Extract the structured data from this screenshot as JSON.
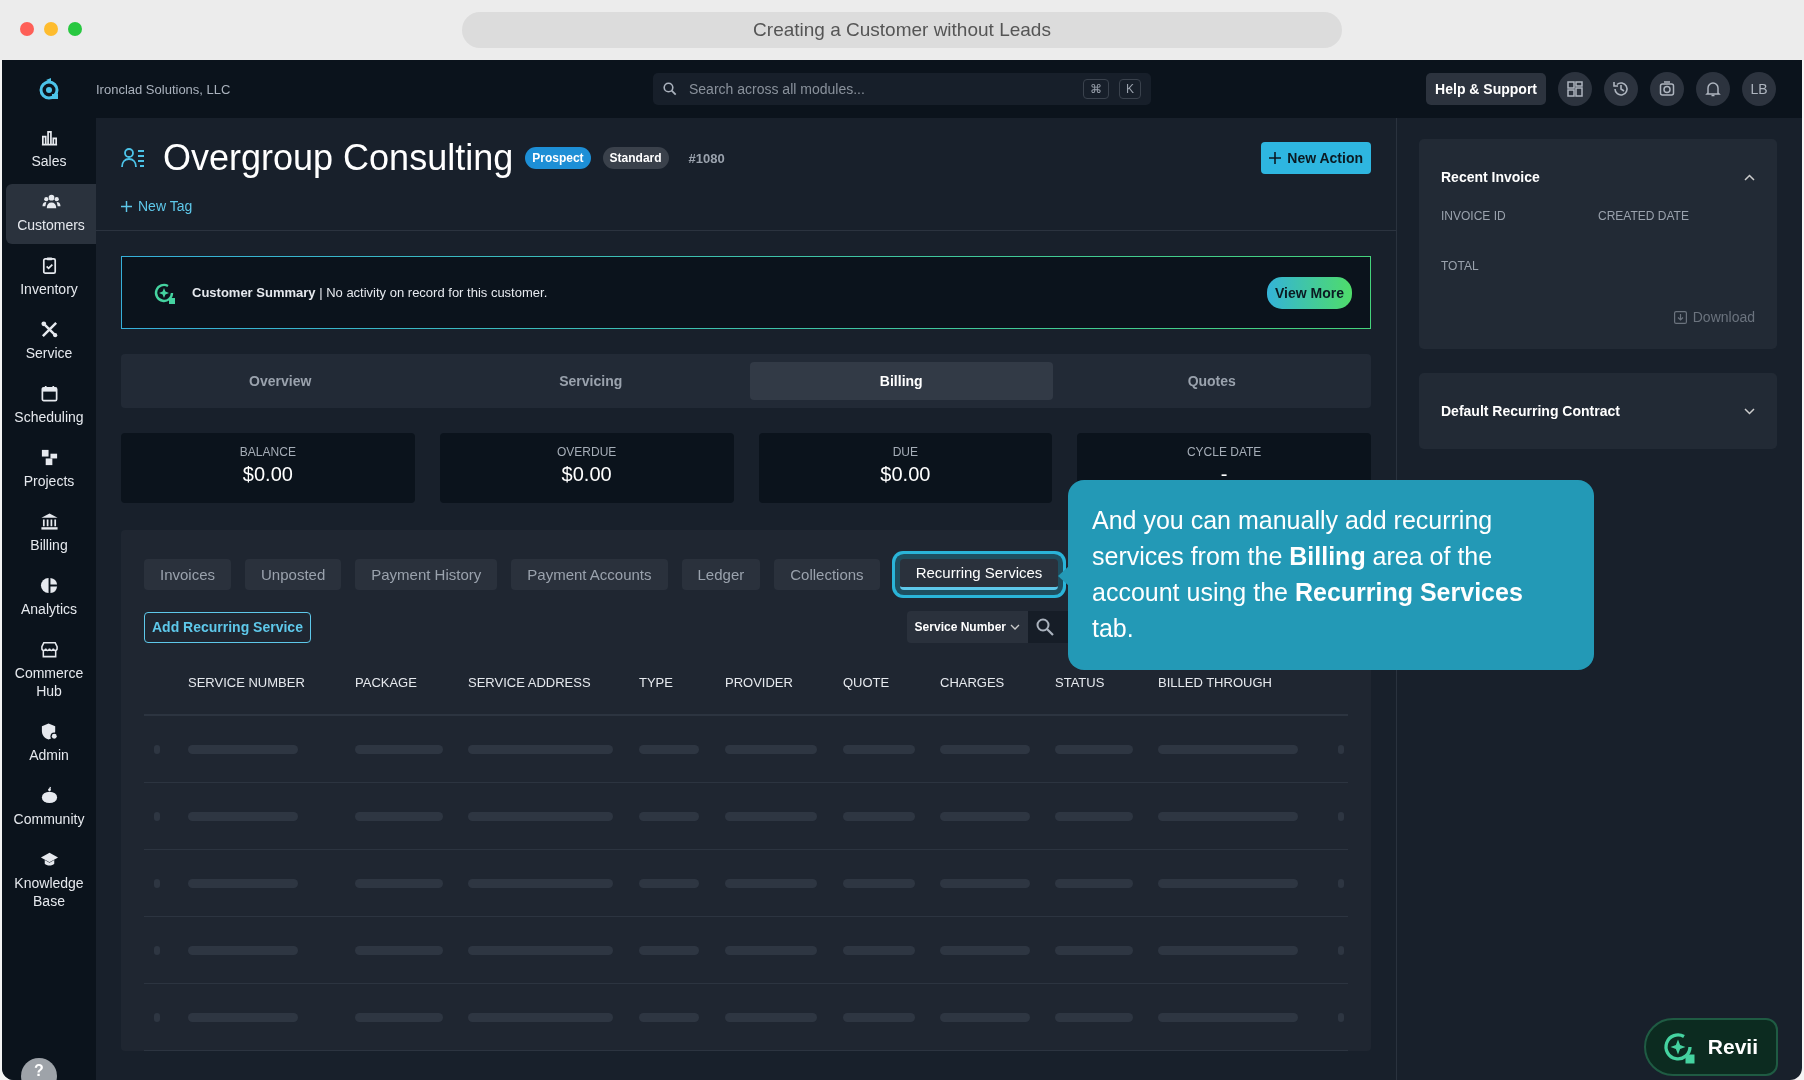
{
  "browser": {
    "title": "Creating a Customer without Leads"
  },
  "topbar": {
    "company": "Ironclad Solutions, LLC",
    "search": {
      "placeholder": "Search across all modules...",
      "keys": [
        "⌘",
        "K"
      ]
    },
    "help": "Help & Support",
    "avatar": "LB"
  },
  "sidebar": {
    "items": [
      {
        "label": "Sales",
        "selected": false
      },
      {
        "label": "Customers",
        "selected": true
      },
      {
        "label": "Inventory",
        "selected": false
      },
      {
        "label": "Service",
        "selected": false
      },
      {
        "label": "Scheduling",
        "selected": false
      },
      {
        "label": "Projects",
        "selected": false
      },
      {
        "label": "Billing",
        "selected": false
      },
      {
        "label": "Analytics",
        "selected": false
      },
      {
        "label": "Commerce Hub",
        "selected": false
      },
      {
        "label": "Admin",
        "selected": false
      },
      {
        "label": "Community",
        "selected": false
      },
      {
        "label": "Knowledge Base",
        "selected": false
      }
    ],
    "help": "?"
  },
  "header": {
    "title": "Overgroup Consulting",
    "badges": [
      {
        "label": "Prospect",
        "kind": "status"
      },
      {
        "label": "Standard",
        "kind": "tier"
      }
    ],
    "number": "#1080",
    "new_action": "New Action",
    "new_tag": "New Tag"
  },
  "summary": {
    "title": "Customer Summary",
    "text": "| No activity on record for this customer.",
    "button": "View More"
  },
  "tabs": [
    {
      "label": "Overview",
      "selected": false
    },
    {
      "label": "Servicing",
      "selected": false
    },
    {
      "label": "Billing",
      "selected": true
    },
    {
      "label": "Quotes",
      "selected": false
    }
  ],
  "stats": [
    {
      "label": "BALANCE",
      "value": "$0.00"
    },
    {
      "label": "OVERDUE",
      "value": "$0.00"
    },
    {
      "label": "DUE",
      "value": "$0.00"
    },
    {
      "label": "CYCLE DATE",
      "value": "-"
    }
  ],
  "subtabs": [
    {
      "label": "Invoices",
      "selected": false
    },
    {
      "label": "Unposted",
      "selected": false
    },
    {
      "label": "Payment History",
      "selected": false
    },
    {
      "label": "Payment Accounts",
      "selected": false
    },
    {
      "label": "Ledger",
      "selected": false
    },
    {
      "label": "Collections",
      "selected": false
    },
    {
      "label": "Recurring Services",
      "selected": true
    }
  ],
  "toolbar": {
    "add_button": "Add Recurring Service",
    "filter": "Service Number"
  },
  "table": {
    "columns": [
      "SERVICE NUMBER",
      "PACKAGE",
      "SERVICE ADDRESS",
      "TYPE",
      "PROVIDER",
      "QUOTE",
      "CHARGES",
      "STATUS",
      "BILLED THROUGH"
    ],
    "rows": [
      {
        "kind": "loading"
      },
      {
        "kind": "loading"
      },
      {
        "kind": "loading"
      },
      {
        "kind": "loading"
      },
      {
        "kind": "loading"
      }
    ]
  },
  "right_panel": {
    "cards": [
      {
        "title": "Recent Invoice",
        "expanded": true,
        "fields": [
          "INVOICE ID",
          "CREATED DATE",
          "TOTAL"
        ],
        "action": {
          "label": "Download",
          "disabled": true
        }
      },
      {
        "title": "Default Recurring Contract",
        "expanded": false
      }
    ]
  },
  "tooltip": {
    "text": "And you can manually add recurring services from the **Billing** area of the account using the **Recurring Services** tab."
  },
  "assistant": {
    "label": "Revii"
  }
}
